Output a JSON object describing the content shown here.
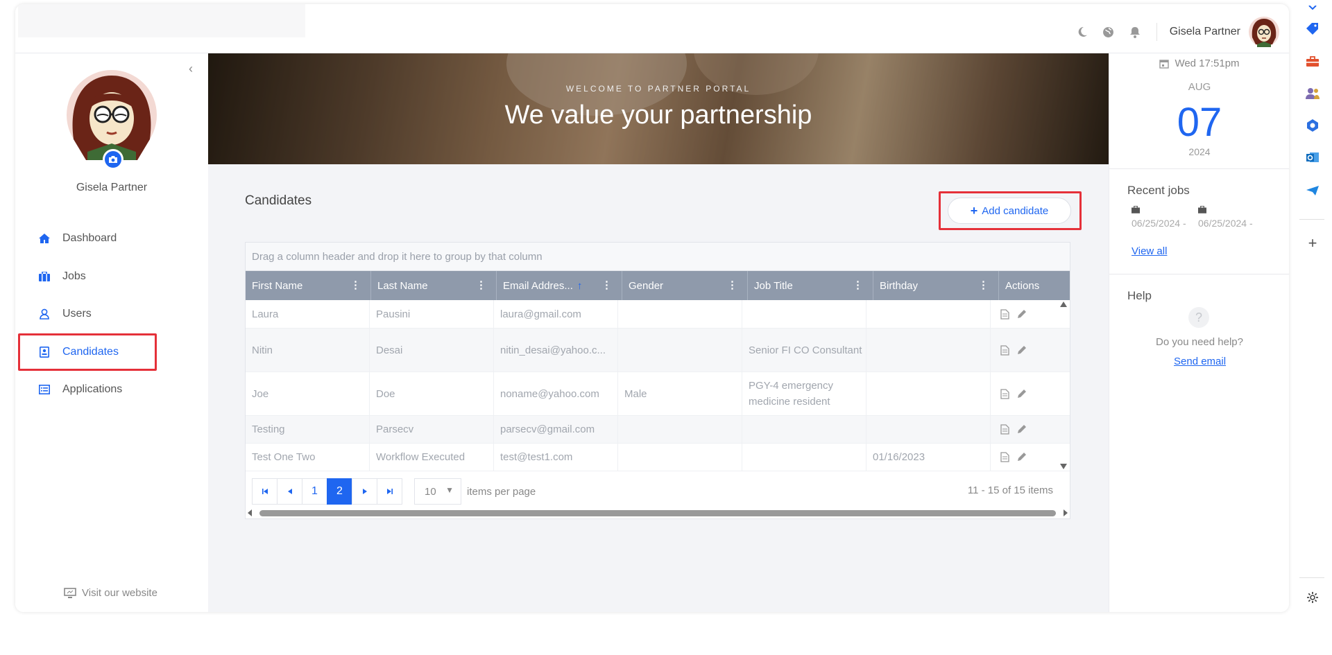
{
  "topbar": {
    "user_name": "Gisela Partner"
  },
  "sidebar": {
    "profile_name": "Gisela Partner",
    "items": [
      {
        "label": "Dashboard",
        "icon": "home-icon"
      },
      {
        "label": "Jobs",
        "icon": "briefcase-icon"
      },
      {
        "label": "Users",
        "icon": "user-icon"
      },
      {
        "label": "Candidates",
        "icon": "candidate-icon",
        "active": true
      },
      {
        "label": "Applications",
        "icon": "list-icon"
      }
    ],
    "visit_label": "Visit our website"
  },
  "banner": {
    "welcome": "WELCOME TO PARTNER PORTAL",
    "title": "We value your partnership"
  },
  "candidates": {
    "title": "Candidates",
    "add_label": "Add candidate",
    "group_hint": "Drag a column header and drop it here to group by that column",
    "columns": [
      "First Name",
      "Last Name",
      "Email Addres...",
      "Gender",
      "Job Title",
      "Birthday",
      "Actions"
    ],
    "sort_column": "Email Addres...",
    "rows": [
      {
        "first": "Laura",
        "last": "Pausini",
        "email": "laura@gmail.com",
        "gender": "",
        "job": "",
        "birthday": ""
      },
      {
        "first": "Nitin",
        "last": "Desai",
        "email": "nitin_desai@yahoo.c...",
        "gender": "",
        "job": "Senior FI CO Consultant",
        "birthday": ""
      },
      {
        "first": "Joe",
        "last": "Doe",
        "email": "noname@yahoo.com",
        "gender": "Male",
        "job": "PGY-4 emergency medicine resident",
        "birthday": ""
      },
      {
        "first": "Testing",
        "last": "Parsecv",
        "email": "parsecv@gmail.com",
        "gender": "",
        "job": "",
        "birthday": ""
      },
      {
        "first": "Test One Two",
        "last": "Workflow Executed",
        "email": "test@test1.com",
        "gender": "",
        "job": "",
        "birthday": "01/16/2023"
      }
    ],
    "pager": {
      "pages": [
        "1",
        "2"
      ],
      "current_page": "2",
      "page_size": "10",
      "page_size_label": "items per page",
      "info": "11 - 15 of 15 items"
    }
  },
  "right_panel": {
    "date_line": "Wed 17:51pm",
    "month": "AUG",
    "day": "07",
    "year": "2024",
    "recent_jobs_title": "Recent jobs",
    "recent_jobs": [
      "06/25/2024 -",
      "06/25/2024 -"
    ],
    "view_all": "View all",
    "help_title": "Help",
    "help_text": "Do you need help?",
    "send_email": "Send email"
  },
  "colors": {
    "accent": "#1f66f0",
    "highlight": "#e53039",
    "header": "#8f9aab"
  }
}
